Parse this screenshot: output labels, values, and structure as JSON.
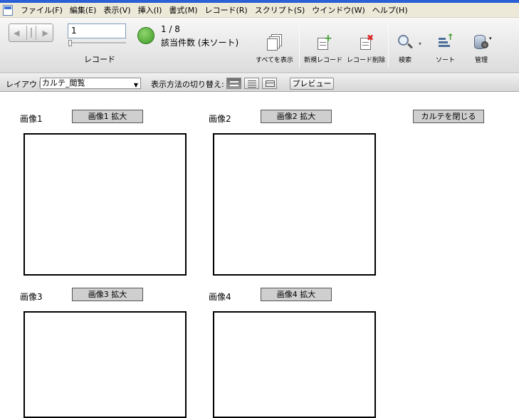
{
  "menu": [
    "ファイル(F)",
    "編集(E)",
    "表示(V)",
    "挿入(I)",
    "書式(M)",
    "レコード(R)",
    "スクリプト(S)",
    "ウインドウ(W)",
    "ヘルプ(H)"
  ],
  "toolbar": {
    "record_value": "1",
    "record_label": "レコード",
    "count": "1 / 8",
    "found_status": "該当件数 (未ソート)",
    "buttons": {
      "show_all": "すべてを表示",
      "new_record": "新規レコード",
      "delete_record": "レコード削除",
      "find": "検索",
      "sort": "ソート",
      "manage": "管理"
    }
  },
  "layoutbar": {
    "layout_label": "レイアウト:",
    "layout_value": "カルテ_閲覧",
    "view_label": "表示方法の切り替え:",
    "preview": "プレビュー"
  },
  "content": {
    "images": [
      {
        "label": "画像1",
        "button": "画像1 拡大"
      },
      {
        "label": "画像2",
        "button": "画像2 拡大"
      },
      {
        "label": "画像3",
        "button": "画像3 拡大"
      },
      {
        "label": "画像4",
        "button": "画像4 拡大"
      }
    ],
    "close_button": "カルテを閉じる"
  }
}
